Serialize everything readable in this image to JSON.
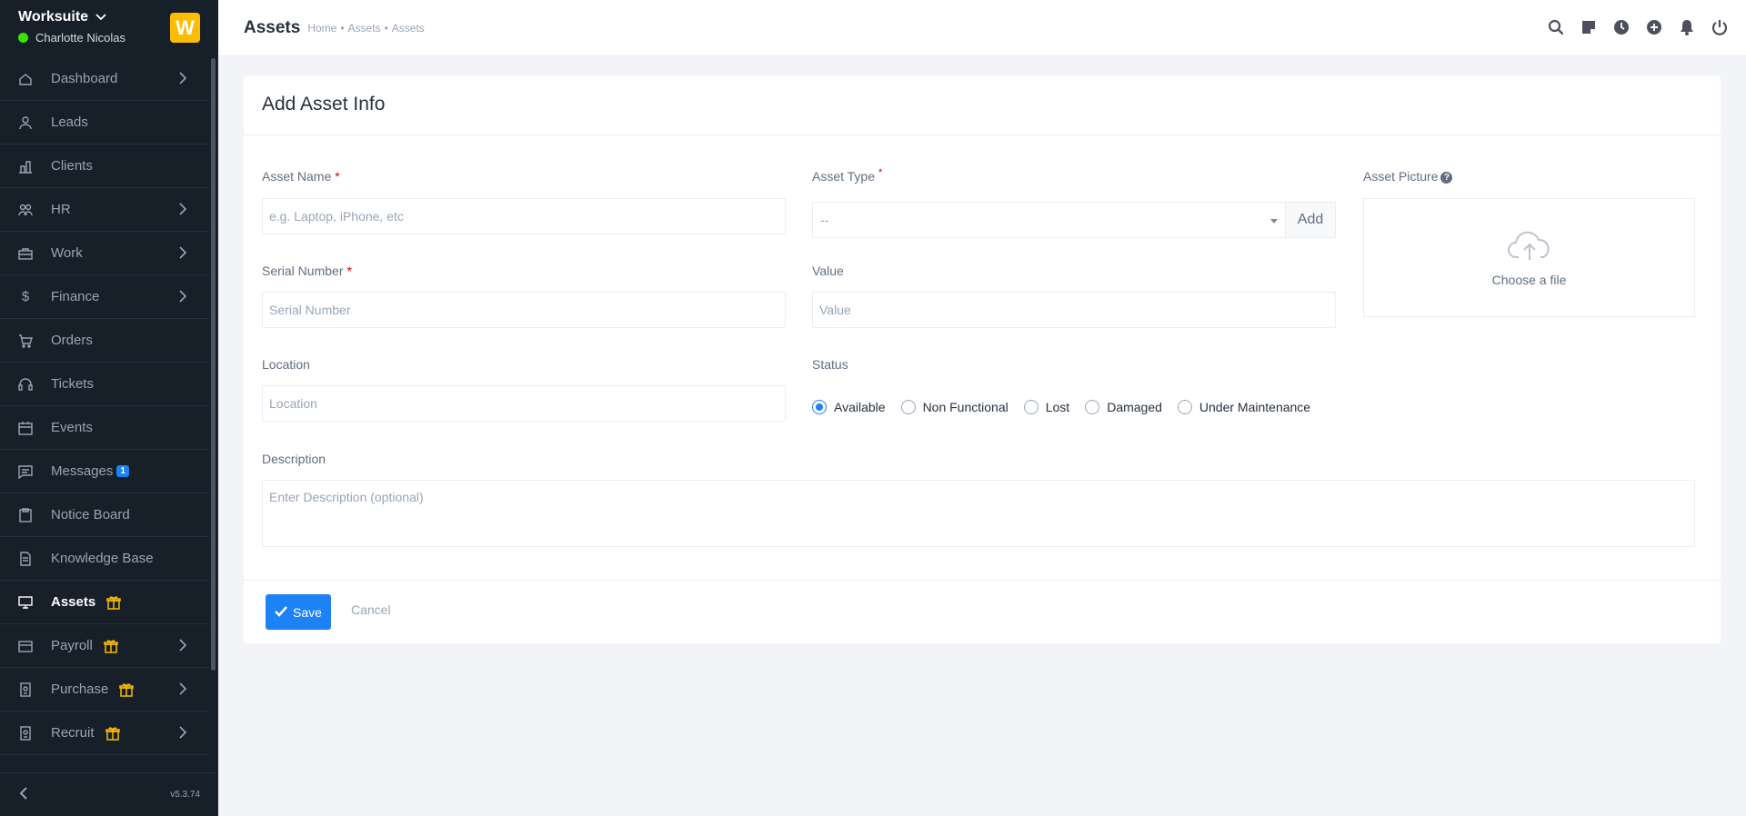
{
  "brand": {
    "name": "Worksuite",
    "user": "Charlotte Nicolas",
    "logo_letter": "W"
  },
  "sidebar": {
    "items": [
      {
        "label": "Dashboard",
        "icon": "house-icon"
      },
      {
        "label": "Leads",
        "icon": "person-icon"
      },
      {
        "label": "Clients",
        "icon": "building-icon"
      },
      {
        "label": "HR",
        "icon": "people-icon"
      },
      {
        "label": "Work",
        "icon": "briefcase-icon"
      },
      {
        "label": "Finance",
        "icon": "dollar-icon"
      },
      {
        "label": "Orders",
        "icon": "cart-icon"
      },
      {
        "label": "Tickets",
        "icon": "headset-icon"
      },
      {
        "label": "Events",
        "icon": "calendar-icon"
      },
      {
        "label": "Messages",
        "icon": "chat-icon",
        "badge": "1"
      },
      {
        "label": "Notice Board",
        "icon": "clipboard-icon"
      },
      {
        "label": "Knowledge Base",
        "icon": "document-icon"
      },
      {
        "label": "Assets",
        "icon": "monitor-icon"
      },
      {
        "label": "Payroll",
        "icon": "wallet-icon"
      },
      {
        "label": "Purchase",
        "icon": "receipt-icon"
      },
      {
        "label": "Recruit",
        "icon": "badge-icon"
      }
    ],
    "version": "v5.3.74"
  },
  "header": {
    "title": "Assets",
    "breadcrumb": [
      "Home",
      "•",
      "Assets",
      "•",
      "Assets"
    ]
  },
  "form": {
    "title": "Add Asset Info",
    "asset_name": {
      "label": "Asset Name",
      "placeholder": "e.g. Laptop, iPhone, etc"
    },
    "asset_type": {
      "label": "Asset Type",
      "value": "--",
      "add_label": "Add"
    },
    "asset_picture": {
      "label": "Asset Picture",
      "upload_text": "Choose a file"
    },
    "serial_number": {
      "label": "Serial Number",
      "placeholder": "Serial Number"
    },
    "value": {
      "label": "Value",
      "placeholder": "Value"
    },
    "location": {
      "label": "Location",
      "placeholder": "Location"
    },
    "status": {
      "label": "Status",
      "options": [
        "Available",
        "Non Functional",
        "Lost",
        "Damaged",
        "Under Maintenance"
      ],
      "selected": "Available"
    },
    "description": {
      "label": "Description",
      "placeholder": "Enter Description (optional)"
    },
    "required_mark": "*",
    "save_label": "Save",
    "cancel_label": "Cancel"
  },
  "colors": {
    "sidebar_bg": "#171f29",
    "accent": "#1d82f5",
    "logo": "#fcbd01"
  }
}
